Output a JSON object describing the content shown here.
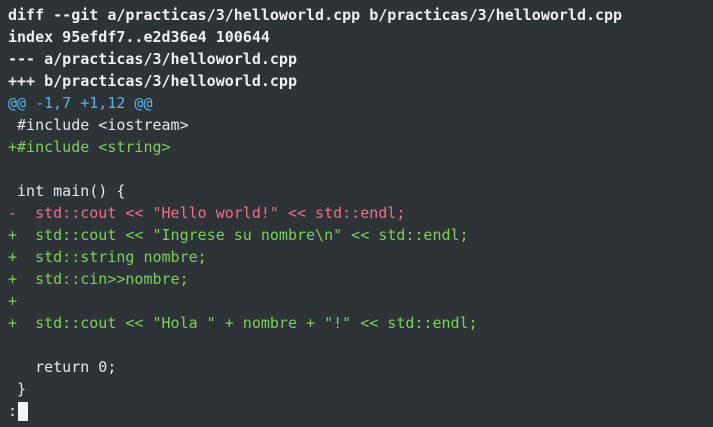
{
  "diff": {
    "header_lines": [
      "diff --git a/practicas/3/helloworld.cpp b/practicas/3/helloworld.cpp",
      "index 95efdf7..e2d36e4 100644",
      "--- a/practicas/3/helloworld.cpp",
      "+++ b/practicas/3/helloworld.cpp"
    ],
    "hunk_header": "@@ -1,7 +1,12 @@",
    "lines": [
      {
        "type": "context",
        "text": " #include <iostream>"
      },
      {
        "type": "added",
        "text": "+#include <string>"
      },
      {
        "type": "context",
        "text": " "
      },
      {
        "type": "context",
        "text": " int main() {"
      },
      {
        "type": "removed",
        "text": "-  std::cout << \"Hello world!\" << std::endl;"
      },
      {
        "type": "added",
        "text": "+  std::cout << \"Ingrese su nombre\\n\" << std::endl;"
      },
      {
        "type": "added",
        "text": "+  std::string nombre;"
      },
      {
        "type": "added",
        "text": "+  std::cin>>nombre;"
      },
      {
        "type": "added",
        "text": "+"
      },
      {
        "type": "added",
        "text": "+  std::cout << \"Hola \" + nombre + \"!\" << std::endl;"
      },
      {
        "type": "context",
        "text": " "
      },
      {
        "type": "context",
        "text": "   return 0;"
      },
      {
        "type": "context",
        "text": " }"
      }
    ]
  },
  "pager": {
    "prompt": ":"
  },
  "colors": {
    "background": "#2e3338",
    "header": "#eef0f3",
    "hunk": "#56b6e6",
    "added": "#7ccf5b",
    "removed": "#ee6f86",
    "context": "#e6e8eb"
  }
}
